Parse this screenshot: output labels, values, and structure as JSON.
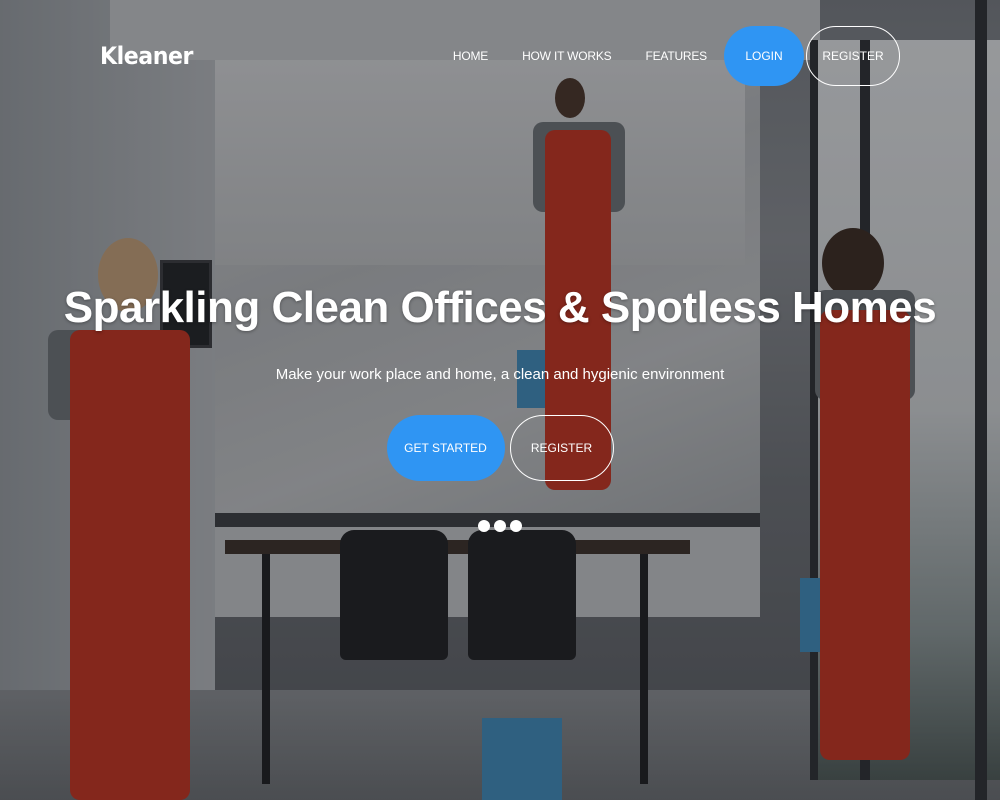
{
  "brand": {
    "name": "Kleaner"
  },
  "nav": {
    "links": [
      "HOME",
      "HOW IT WORKS",
      "FEATURES"
    ],
    "login_label": "LOGIN",
    "register_label": "REGISTER"
  },
  "hero": {
    "headline": "Sparkling Clean Offices & Spotless Homes",
    "subline": "Make your work place and home, a clean and hygienic environment",
    "get_started_label": "GET STARTED",
    "register_label": "REGISTER",
    "carousel_dot_count": 3
  },
  "colors": {
    "accent": "#2f95f3",
    "text": "#ffffff"
  }
}
